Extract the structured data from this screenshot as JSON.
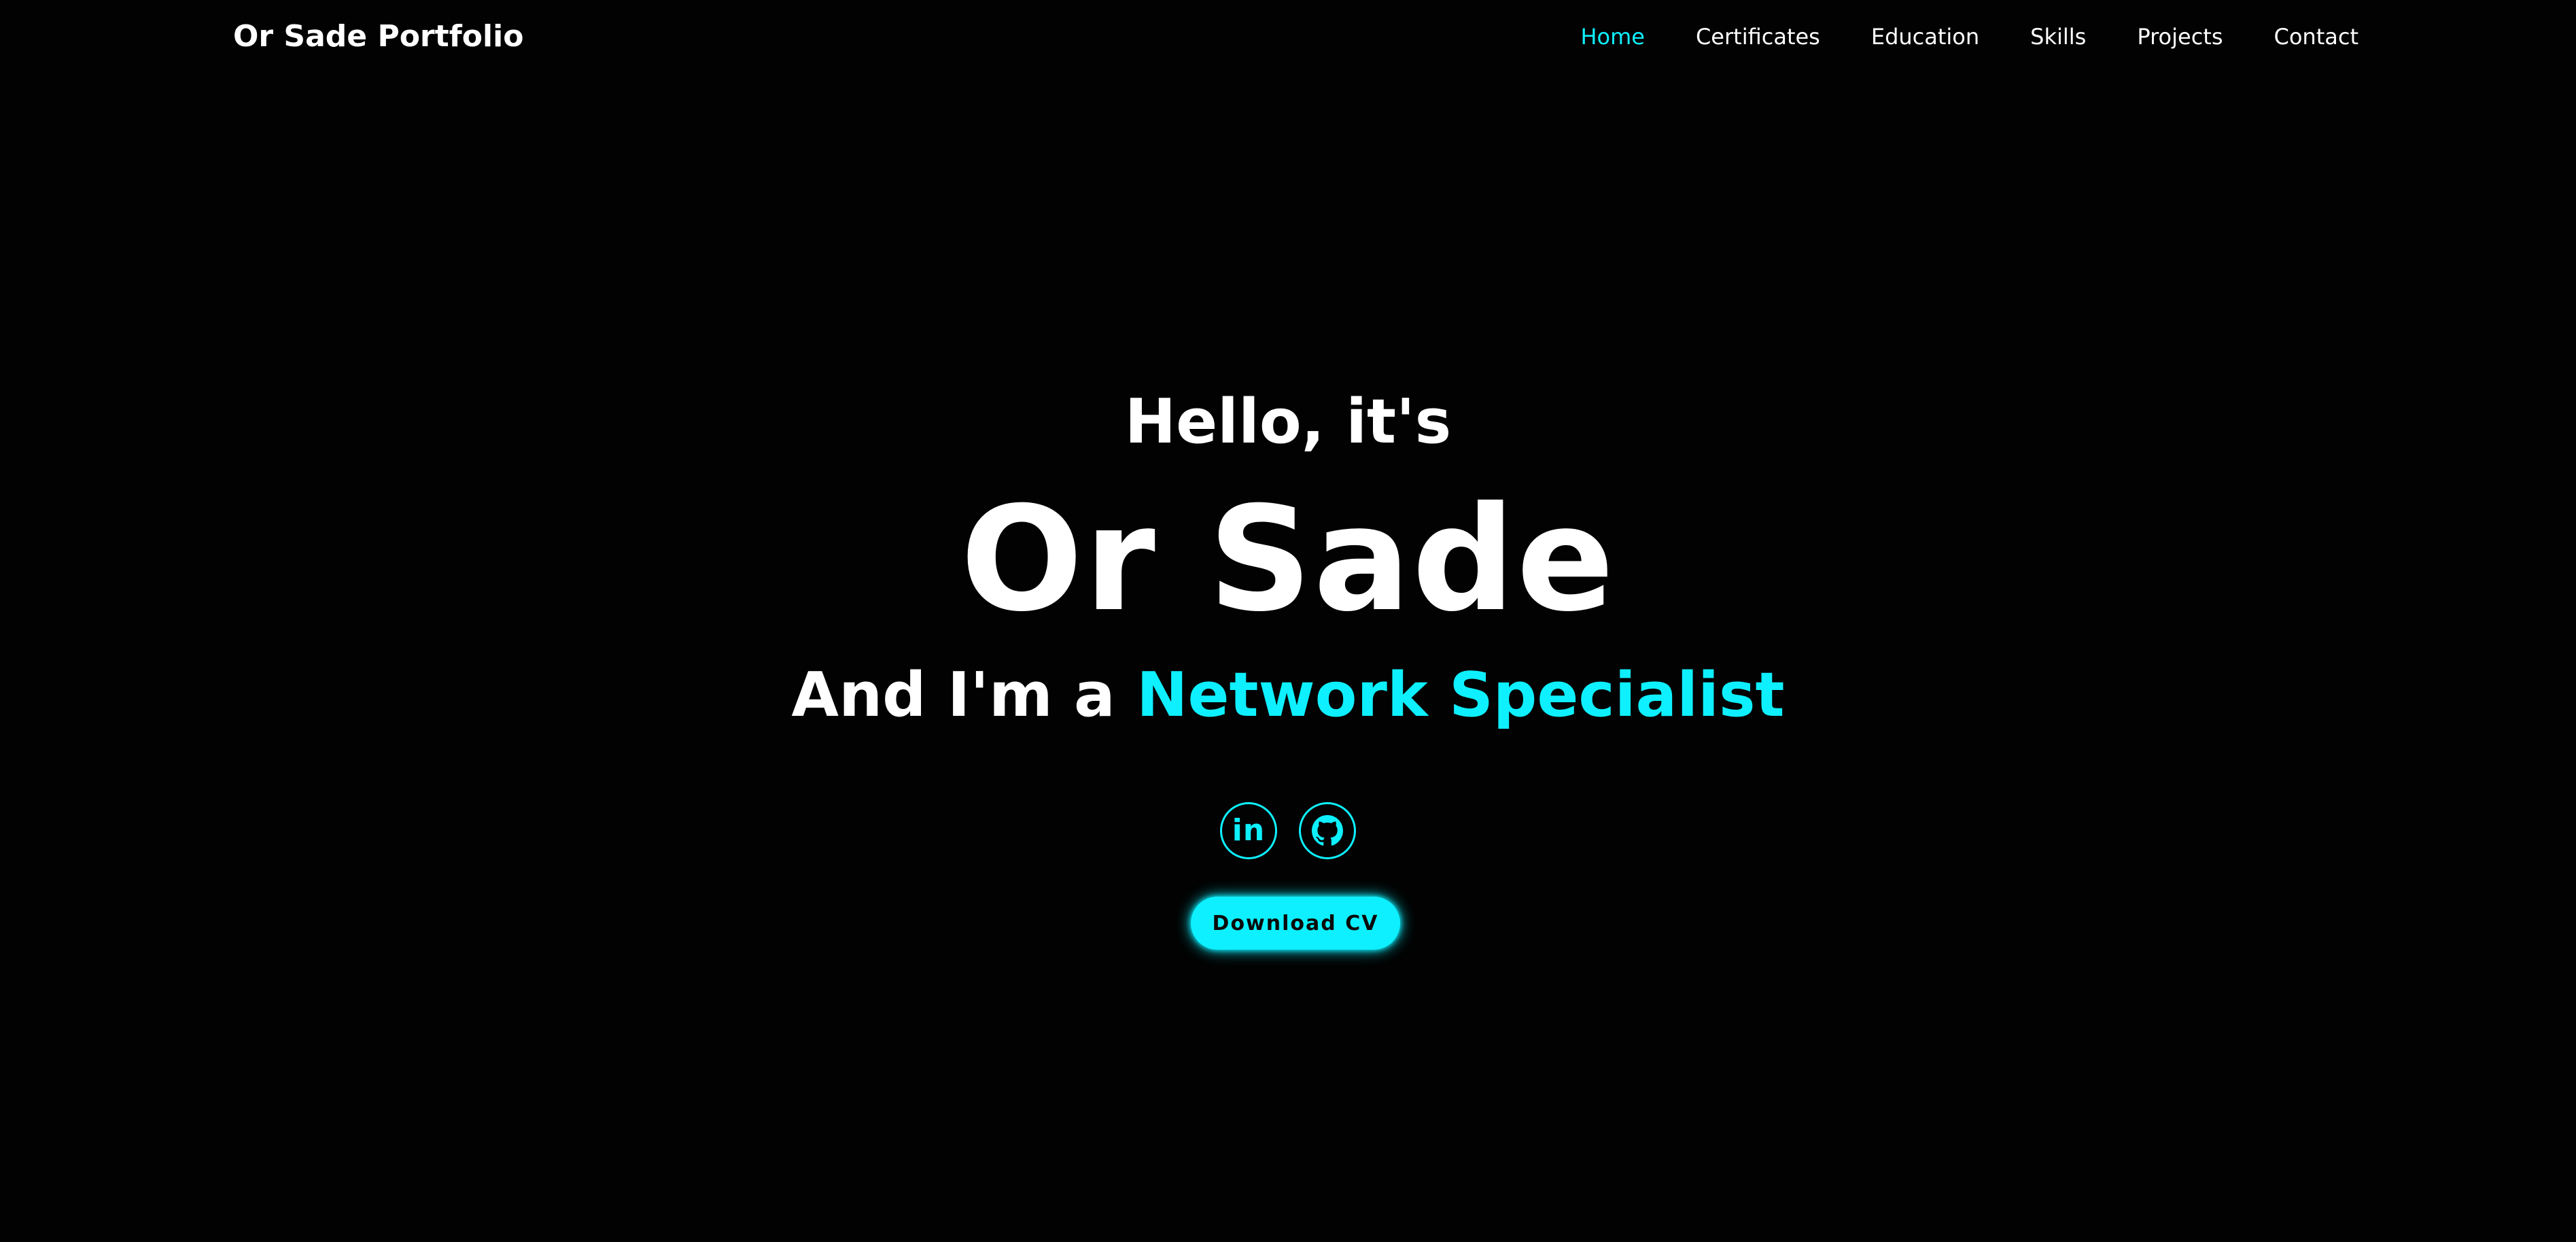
{
  "header": {
    "logo": "Or Sade Portfolio",
    "nav": [
      {
        "label": "Home",
        "active": true
      },
      {
        "label": "Certificates",
        "active": false
      },
      {
        "label": "Education",
        "active": false
      },
      {
        "label": "Skills",
        "active": false
      },
      {
        "label": "Projects",
        "active": false
      },
      {
        "label": "Contact",
        "active": false
      }
    ]
  },
  "hero": {
    "greeting": "Hello, it's",
    "name": "Or Sade",
    "role_prefix": "And I'm a",
    "role_highlight": "Network Specialist",
    "socials": [
      {
        "icon": "linkedin-icon",
        "label": "in"
      },
      {
        "icon": "github-icon"
      }
    ],
    "cta_label": "Download CV"
  },
  "colors": {
    "background": "#020202",
    "accent": "#0ef0ff",
    "text": "#ffffff"
  }
}
